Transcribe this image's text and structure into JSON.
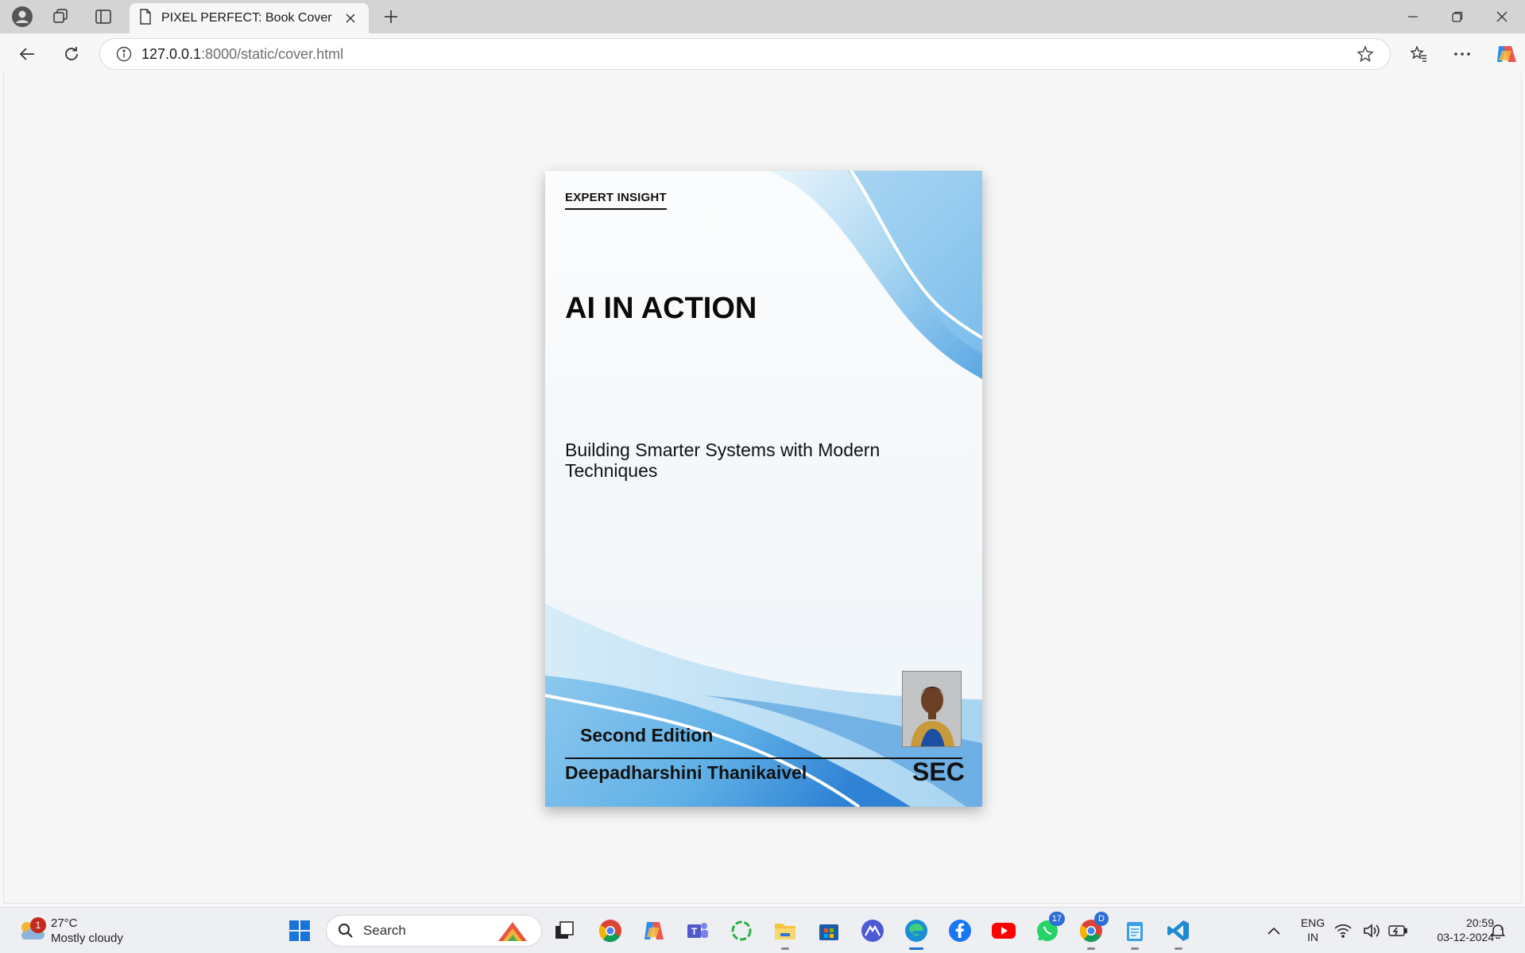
{
  "browser": {
    "tab": {
      "title": "PIXEL PERFECT: Book Cover"
    },
    "address": {
      "host": "127.0.0.1",
      "rest": ":8000/static/cover.html"
    }
  },
  "cover": {
    "label": "EXPERT INSIGHT",
    "title": "AI IN ACTION",
    "subtitle": "Building Smarter Systems with Modern Techniques",
    "edition": "Second Edition",
    "author": "Deepadharshini Thanikaivel",
    "publisher": "SEC"
  },
  "taskbar": {
    "weather": {
      "temp": "27°C",
      "condition": "Mostly cloudy",
      "badge": "1"
    },
    "search_placeholder": "Search",
    "teams_badge": "17",
    "whatsapp_badge": "17",
    "chrome_profile_badge": "D",
    "language": {
      "line1": "ENG",
      "line2": "IN"
    },
    "clock": {
      "time": "20:59",
      "date": "03-12-2024"
    }
  },
  "colors": {
    "accent_blue": "#1a6fd6",
    "wave_light": "#b8e0f5",
    "wave_mid": "#6cb6e8",
    "wave_dark": "#2a7fd0"
  }
}
